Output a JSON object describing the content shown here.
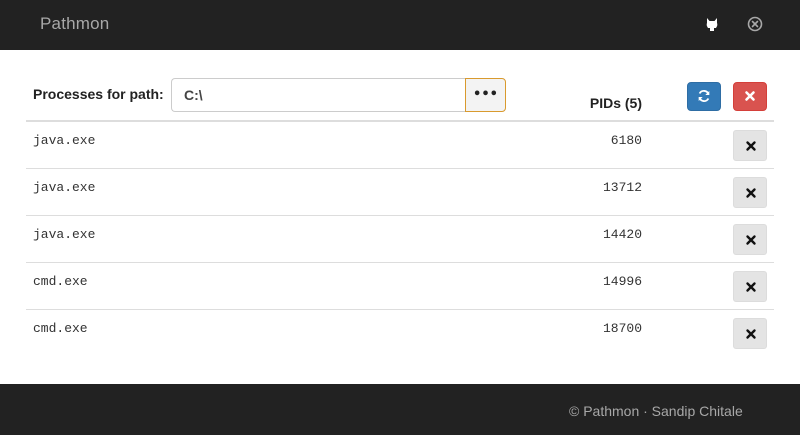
{
  "app": {
    "title": "Pathmon"
  },
  "header": {
    "github_icon": "github-icon",
    "close_icon": "close-circle-icon"
  },
  "path_bar": {
    "label": "Processes for path:",
    "value": "C:\\",
    "browse_label": "•••"
  },
  "table": {
    "pids_header": "PIDs (5)",
    "refresh_icon": "refresh-icon",
    "clear_icon": "remove-icon",
    "rows": [
      {
        "name": "java.exe",
        "pid": "6180"
      },
      {
        "name": "java.exe",
        "pid": "13712"
      },
      {
        "name": "java.exe",
        "pid": "14420"
      },
      {
        "name": "cmd.exe",
        "pid": "14996"
      },
      {
        "name": "cmd.exe",
        "pid": "18700"
      }
    ]
  },
  "footer": {
    "text": "© Pathmon · Sandip Chitale"
  },
  "colors": {
    "navbar": "#222222",
    "primary": "#337ab7",
    "danger": "#d9534f",
    "focus_border": "#d99a2e"
  }
}
